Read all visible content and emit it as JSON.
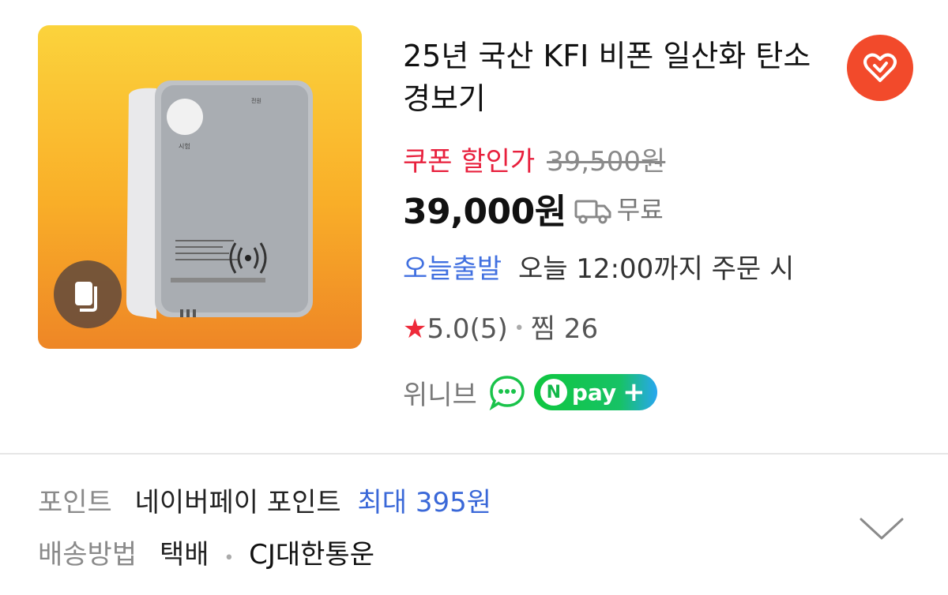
{
  "product": {
    "title": "25년 국산 KFI 비폰 일산화 탄소 경보기",
    "coupon_label": "쿠폰 할인가",
    "original_price": "39,500원",
    "price": "39,000원",
    "shipping": "무료",
    "today_label": "오늘출발",
    "today_desc": "오늘 12:00까지 주문 시",
    "rating": "5.0",
    "review_count": "(5)",
    "wish": "찜 26",
    "seller": "위니브",
    "npay_text": "pay",
    "npay_n": "N"
  },
  "info": {
    "point_label": "포인트",
    "point_value": "네이버페이 포인트",
    "point_max": "최대 395원",
    "delivery_label": "배송방법",
    "delivery_value": "택배",
    "delivery_carrier": "CJ대한통운"
  },
  "colors": {
    "accent_red": "#e8203d",
    "accent_blue": "#4170e0",
    "wish_bg": "#f24a2b",
    "npay_green": "#0fc73f"
  },
  "icons": [
    "gallery-icon",
    "heart-icon",
    "truck-icon",
    "star-icon",
    "talk-icon",
    "npay-logo",
    "chevron-down-icon"
  ]
}
